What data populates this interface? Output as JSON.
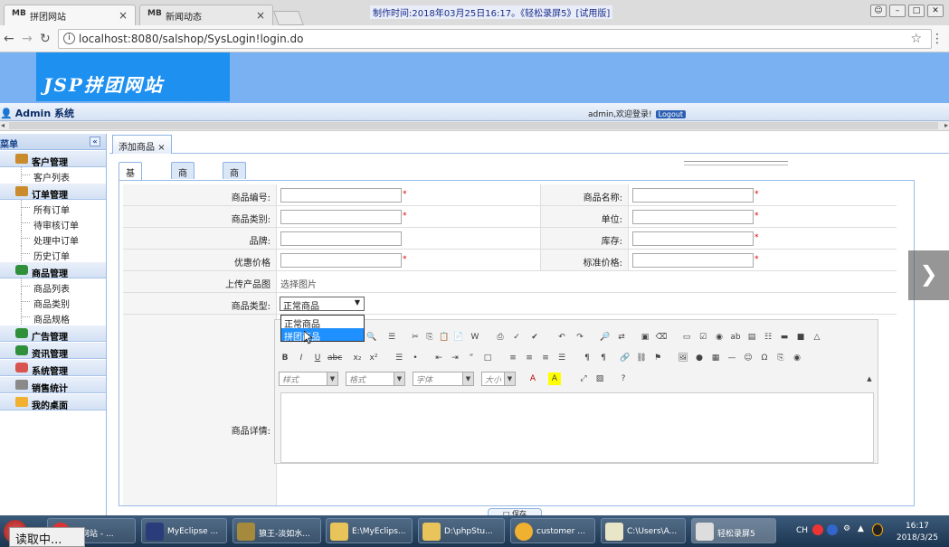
{
  "browser": {
    "tabs": [
      {
        "favicon": "MB",
        "title": "拼团网站",
        "close": "×"
      },
      {
        "favicon": "MB",
        "title": "新闻动态",
        "close": "×"
      }
    ],
    "recorder_title": "制作时间:2018年03月25日16:17。《轻松录屏5》[试用版]",
    "url": "localhost:8080/salshop/SysLogin!login.do"
  },
  "app": {
    "logo_text": "JSP拼团网站",
    "system_title": "Admin 系统",
    "welcome": "admin,欢迎登录!",
    "logout_label": "Logout"
  },
  "sidebar": {
    "header": "菜单",
    "groups": [
      {
        "label": "客户管理",
        "items": [
          "客户列表"
        ]
      },
      {
        "label": "订单管理",
        "items": [
          "所有订单",
          "待审核订单",
          "处理中订单",
          "历史订单"
        ]
      },
      {
        "label": "商品管理",
        "items": [
          "商品列表",
          "商品类别",
          "商品规格"
        ]
      },
      {
        "label": "广告管理",
        "items": []
      },
      {
        "label": "资讯管理",
        "items": []
      },
      {
        "label": "系统管理",
        "items": []
      },
      {
        "label": "销售统计",
        "items": []
      },
      {
        "label": "我的桌面",
        "items": []
      }
    ]
  },
  "main": {
    "panel_tab": "添加商品",
    "inner_tabs": [
      "基本信息",
      "商品规格",
      "商品相册"
    ],
    "form": {
      "code_label": "商品编号:",
      "name_label": "商品名称:",
      "category_label": "商品类别:",
      "unit_label": "单位:",
      "brand_label": "品牌:",
      "stock_label": "库存:",
      "promo_price_label": "优惠价格",
      "std_price_label": "标准价格:",
      "upload_label": "上传产品图",
      "upload_action": "选择图片",
      "type_label": "商品类型:",
      "type_selected": "正常商品",
      "type_options": [
        "正常商品",
        "拼团商品"
      ],
      "detail_label": "商品详情:",
      "required_mark": "*"
    },
    "editor": {
      "style_combo": "样式",
      "format_combo": "格式",
      "font_combo": "字体",
      "size_combo": "大小"
    },
    "save_label": "保存"
  },
  "taskbar": {
    "items": [
      "团网站 - ...",
      "MyEclipse ...",
      "狼王-淡如水...",
      "E:\\MyEclips...",
      "D:\\phpStu...",
      "customer ...",
      "C:\\Users\\A...",
      "轻松录屏5"
    ],
    "tray_lang": "CH",
    "time": "16:17",
    "date": "2018/3/25"
  },
  "overlay_loading": "读取中..."
}
